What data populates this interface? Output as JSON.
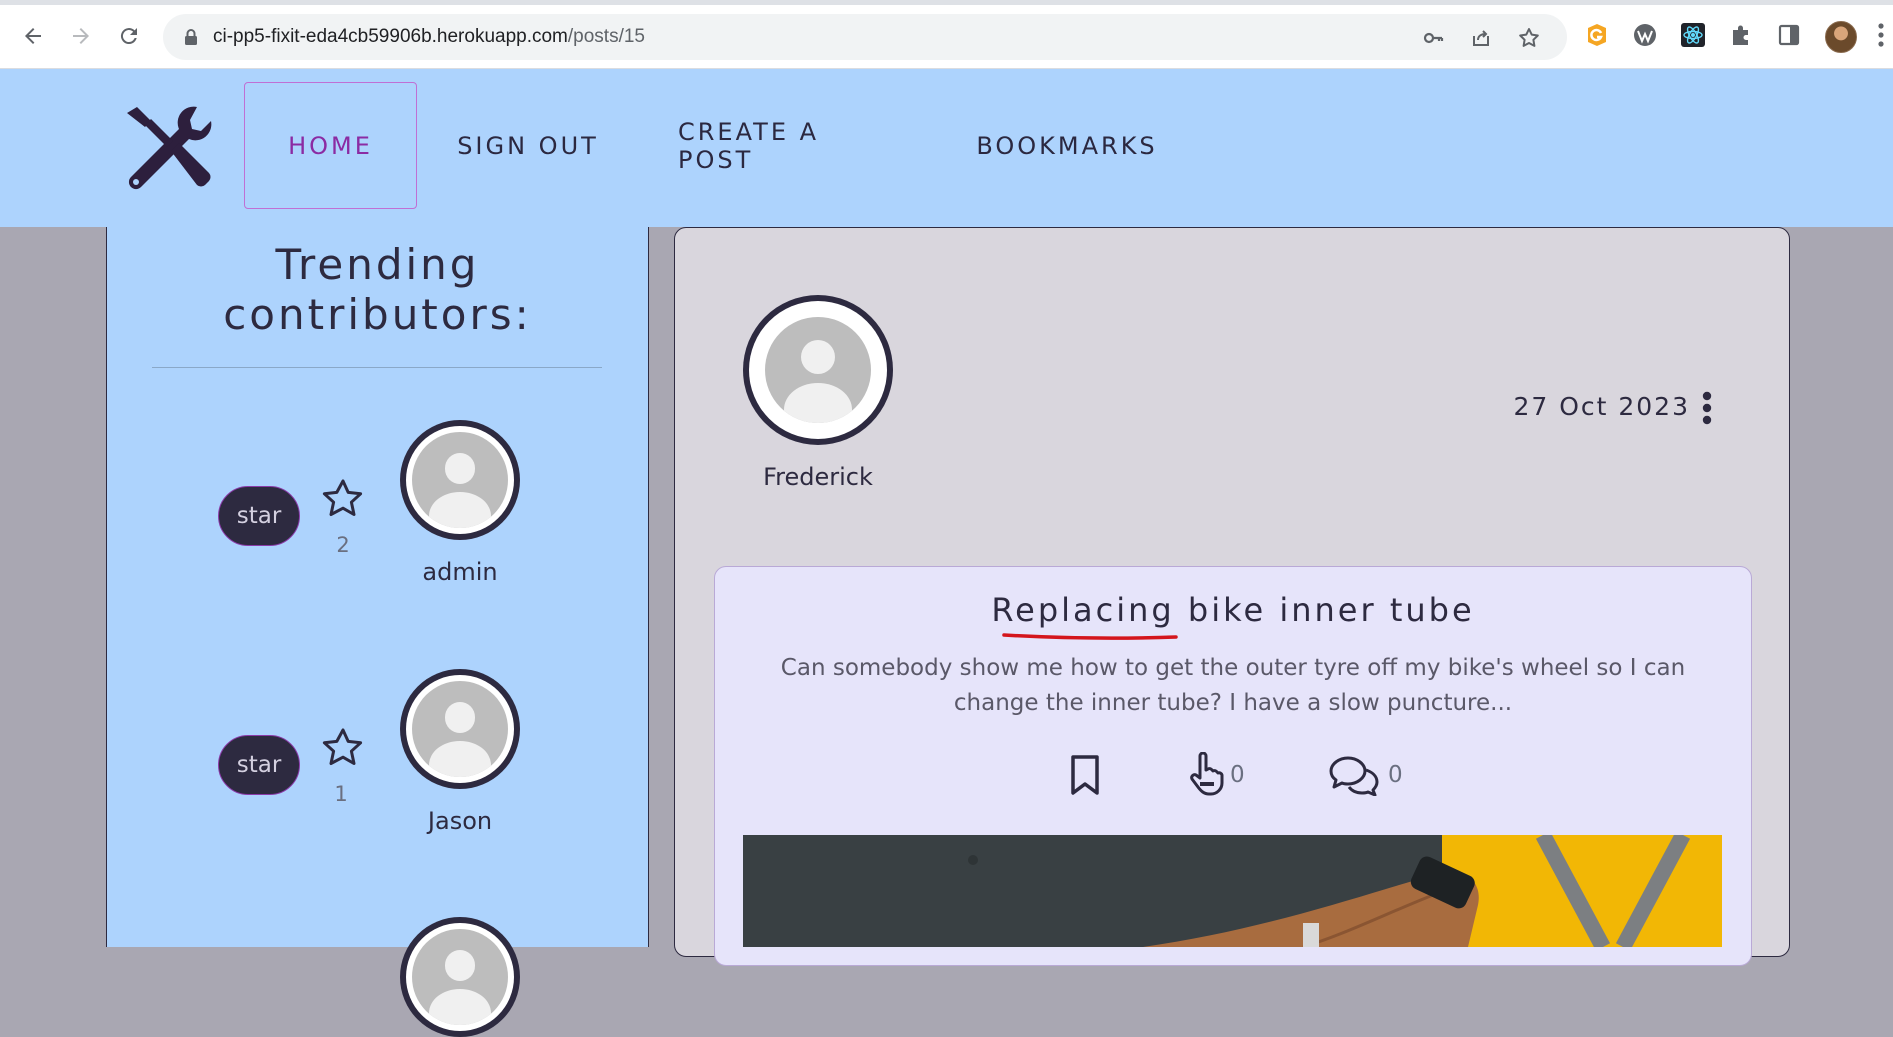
{
  "browser": {
    "url_host": "ci-pp5-fixit-eda4cb59906b.herokuapp.com",
    "url_path": "/posts/15",
    "icons": [
      "back-icon",
      "forward-icon",
      "reload-icon",
      "lock-icon",
      "key-icon",
      "share-icon",
      "bookmark-star-icon",
      "grammarly-icon",
      "wordpress-icon",
      "react-devtools-icon",
      "extensions-puzzle-icon",
      "side-panel-icon",
      "profile-avatar",
      "chrome-menu-icon"
    ]
  },
  "navbar": {
    "logo_icon": "wrench-screwdriver-icon",
    "links": [
      "HOME",
      "SIGN OUT",
      "CREATE A POST",
      "BOOKMARKS"
    ],
    "active": "HOME",
    "colors": {
      "background": "#add3fd",
      "active_link": "#8b2ba3",
      "text": "#2b2840"
    }
  },
  "sidebar": {
    "title_line1": "Trending",
    "title_line2": "contributors:",
    "contributors": [
      {
        "button_label": "star",
        "star_count": "2",
        "name": "admin"
      },
      {
        "button_label": "star",
        "star_count": "1",
        "name": "Jason"
      }
    ]
  },
  "post": {
    "owner": "Frederick",
    "date": "27 Oct 2023",
    "title": "Replacing bike inner tube",
    "content": "Can somebody show me how to get the outer tyre off my bike's wheel so I can change the inner tube? I have a slow puncture...",
    "likes_count": "0",
    "comments_count": "0",
    "icons": [
      "bookmark-icon",
      "hand-pointer-like-icon",
      "comments-icon",
      "more-options-icon"
    ],
    "image_alt": "bike handlebar with brown bar tape"
  }
}
